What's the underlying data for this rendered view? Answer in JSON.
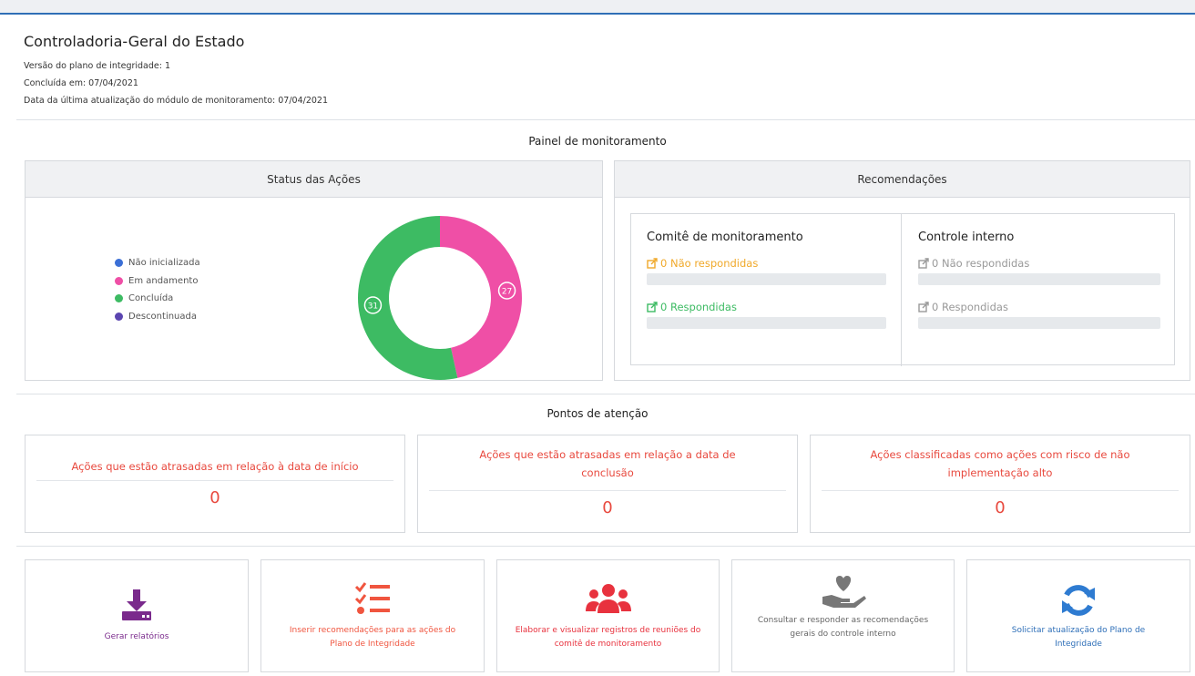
{
  "header": {
    "org_title": "Controladoria-Geral do Estado",
    "version_line": "Versão do plano de integridade: 1",
    "concluded_line": "Concluída em: 07/04/2021",
    "updated_line": "Data da última atualização do módulo de monitoramento: 07/04/2021"
  },
  "monitoring": {
    "title": "Painel de monitoramento",
    "status_panel": {
      "title": "Status das Ações",
      "legend": [
        {
          "label": "Não inicializada",
          "color": "#3b6fd6"
        },
        {
          "label": "Em andamento",
          "color": "#ef4fa6"
        },
        {
          "label": "Concluída",
          "color": "#3dbb63"
        },
        {
          "label": "Descontinuada",
          "color": "#5b45b0"
        }
      ]
    },
    "recommendations_panel": {
      "title": "Recomendações",
      "committee": {
        "title": "Comitê de monitoramento",
        "not_answered": "0 Não respondidas",
        "answered": "0 Respondidas"
      },
      "internal_control": {
        "title": "Controle interno",
        "not_answered": "0 Não respondidas",
        "answered": "0 Respondidas"
      }
    }
  },
  "chart_data": {
    "type": "pie",
    "title": "Status das Ações",
    "categories": [
      "Não inicializada",
      "Em andamento",
      "Concluída",
      "Descontinuada"
    ],
    "values": [
      0,
      27,
      31,
      0
    ],
    "colors": [
      "#3b6fd6",
      "#ef4fa6",
      "#3dbb63",
      "#5b45b0"
    ],
    "donut": true,
    "legend_position": "left"
  },
  "attention": {
    "title": "Pontos de atenção",
    "cards": [
      {
        "text": "Ações que estão atrasadas em relação à data de início",
        "value": "0"
      },
      {
        "text": "Ações que estão atrasadas em relação a data de conclusão",
        "value": "0"
      },
      {
        "text": "Ações classificadas como ações com risco de não implementação alto",
        "value": "0"
      }
    ]
  },
  "actions": [
    {
      "label": "Gerar relatórios",
      "icon": "download-icon",
      "color": "#7a2a8c"
    },
    {
      "label": "Inserir recomendações para as ações do Plano de Integridade",
      "icon": "checklist-icon",
      "color": "#f0553f"
    },
    {
      "label": "Elaborar e visualizar registros de reuniões do comitê de monitoramento",
      "icon": "users-icon",
      "color": "#e8323e"
    },
    {
      "label": "Consultar e responder as recomendações gerais do controle interno",
      "icon": "hand-heart-icon",
      "color": "#777777"
    },
    {
      "label": "Solicitar atualização do Plano de Integridade",
      "icon": "refresh-icon",
      "color": "#2e7bd1"
    }
  ]
}
